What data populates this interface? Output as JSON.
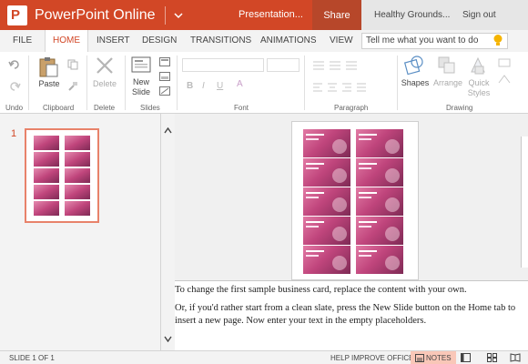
{
  "titlebar": {
    "app_name": "PowerPoint Online",
    "document_name": "Presentation...",
    "share_label": "Share",
    "user_name": "Healthy Grounds...",
    "sign_out_label": "Sign out"
  },
  "tabs": [
    {
      "label": "FILE",
      "active": false
    },
    {
      "label": "HOME",
      "active": true
    },
    {
      "label": "INSERT",
      "active": false
    },
    {
      "label": "DESIGN",
      "active": false
    },
    {
      "label": "TRANSITIONS",
      "active": false
    },
    {
      "label": "ANIMATIONS",
      "active": false
    },
    {
      "label": "VIEW",
      "active": false
    }
  ],
  "tell_me": {
    "placeholder": "Tell me what you want to do"
  },
  "ribbon": {
    "groups": {
      "undo": "Undo",
      "clipboard": "Clipboard",
      "delete": "Delete",
      "slides": "Slides",
      "font": "Font",
      "paragraph": "Paragraph",
      "drawing": "Drawing"
    },
    "paste_label": "Paste",
    "delete_label": "Delete",
    "new_slide_label_1": "New",
    "new_slide_label_2": "Slide",
    "shapes_label": "Shapes",
    "arrange_label": "Arrange",
    "quick_styles_label_1": "Quick",
    "quick_styles_label_2": "Styles"
  },
  "slide_panel": {
    "slide_number": "1"
  },
  "notes": {
    "paragraph_1": "To change the first sample business card, replace the content with your own.",
    "paragraph_2": "Or, if you'd rather start from a clean slate, press the New Slide button on the Home tab to insert a new page. Now enter your text in the empty placeholders."
  },
  "statusbar": {
    "slide_position": "SLIDE 1 OF 1",
    "help_label": "HELP IMPROVE OFFICE",
    "notes_label": "NOTES"
  },
  "colors": {
    "accent": "#d24726",
    "share_bg": "#b7472a",
    "card_pink": "#c0457c"
  }
}
